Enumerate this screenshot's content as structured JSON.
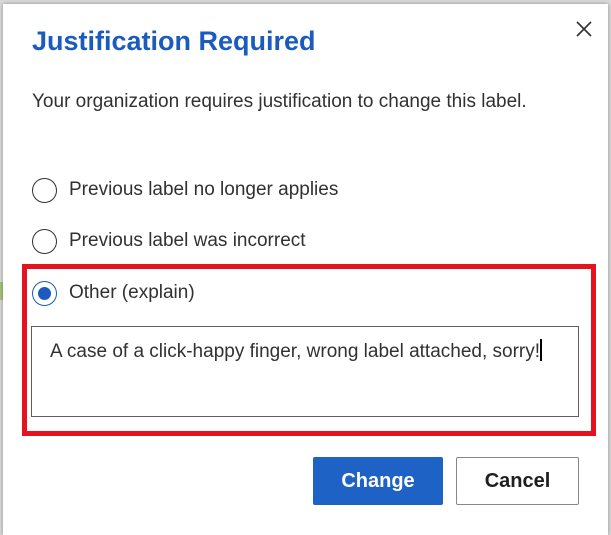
{
  "dialog": {
    "title": "Justification Required",
    "description": "Your organization requires justification to change this label.",
    "close_icon": "close-icon",
    "options": [
      {
        "label": "Previous label no longer applies",
        "selected": false
      },
      {
        "label": "Previous label was incorrect",
        "selected": false
      },
      {
        "label": "Other (explain)",
        "selected": true
      }
    ],
    "explanation": {
      "value": "A case of a click-happy finger, wrong label attached, sorry!"
    },
    "buttons": {
      "change_label": "Change",
      "cancel_label": "Cancel"
    }
  },
  "colors": {
    "accent": "#1a5bbd",
    "primary_button": "#1f62c6",
    "highlight": "#e3141f"
  }
}
